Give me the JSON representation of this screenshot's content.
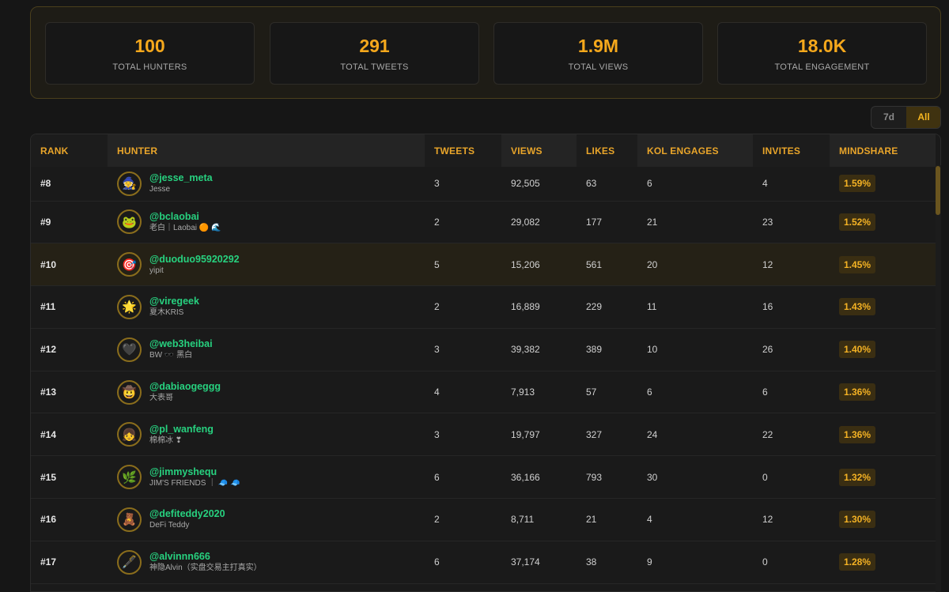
{
  "stats": [
    {
      "value": "100",
      "label": "TOTAL HUNTERS"
    },
    {
      "value": "291",
      "label": "TOTAL TWEETS"
    },
    {
      "value": "1.9M",
      "label": "TOTAL VIEWS"
    },
    {
      "value": "18.0K",
      "label": "TOTAL ENGAGEMENT"
    }
  ],
  "range": {
    "option_7d": "7d",
    "option_all": "All",
    "selected": "All"
  },
  "table": {
    "headers": {
      "rank": "RANK",
      "hunter": "HUNTER",
      "tweets": "TWEETS",
      "views": "VIEWS",
      "likes": "LIKES",
      "kol": "KOL ENGAGES",
      "invites": "INVITES",
      "mindshare": "MINDSHARE"
    },
    "rows": [
      {
        "rank": "#8",
        "handle": "@jesse_meta",
        "name": "Jesse",
        "avatar": "🧙",
        "tweets": "3",
        "views": "92,505",
        "likes": "63",
        "kol": "6",
        "invites": "4",
        "mindshare": "1.59%"
      },
      {
        "rank": "#9",
        "handle": "@bclaobai",
        "name": "老白｜Laobai 🟠 🌊",
        "avatar": "🐸",
        "tweets": "2",
        "views": "29,082",
        "likes": "177",
        "kol": "21",
        "invites": "23",
        "mindshare": "1.52%"
      },
      {
        "rank": "#10",
        "handle": "@duoduo95920292",
        "name": "yipit",
        "avatar": "🎯",
        "tweets": "5",
        "views": "15,206",
        "likes": "561",
        "kol": "20",
        "invites": "12",
        "mindshare": "1.45%"
      },
      {
        "rank": "#11",
        "handle": "@viregeek",
        "name": "夏木KRIS",
        "avatar": "🌟",
        "tweets": "2",
        "views": "16,889",
        "likes": "229",
        "kol": "11",
        "invites": "16",
        "mindshare": "1.43%"
      },
      {
        "rank": "#12",
        "handle": "@web3heibai",
        "name": "BW 🕶️ 黑白",
        "avatar": "🖤",
        "tweets": "3",
        "views": "39,382",
        "likes": "389",
        "kol": "10",
        "invites": "26",
        "mindshare": "1.40%"
      },
      {
        "rank": "#13",
        "handle": "@dabiaogeggg",
        "name": "大表哥",
        "avatar": "🤠",
        "tweets": "4",
        "views": "7,913",
        "likes": "57",
        "kol": "6",
        "invites": "6",
        "mindshare": "1.36%"
      },
      {
        "rank": "#14",
        "handle": "@pl_wanfeng",
        "name": "棉棉冰 ❣",
        "avatar": "👧",
        "tweets": "3",
        "views": "19,797",
        "likes": "327",
        "kol": "24",
        "invites": "22",
        "mindshare": "1.36%"
      },
      {
        "rank": "#15",
        "handle": "@jimmyshequ",
        "name": "JIM'S FRIENDS ｜ 🧢 🧢",
        "avatar": "🌿",
        "tweets": "6",
        "views": "36,166",
        "likes": "793",
        "kol": "30",
        "invites": "0",
        "mindshare": "1.32%"
      },
      {
        "rank": "#16",
        "handle": "@defiteddy2020",
        "name": "DeFi Teddy",
        "avatar": "🧸",
        "tweets": "2",
        "views": "8,711",
        "likes": "21",
        "kol": "4",
        "invites": "12",
        "mindshare": "1.30%"
      },
      {
        "rank": "#17",
        "handle": "@alvinnn666",
        "name": "神隐Alvin（实盘交易主打真实）",
        "avatar": "🖋️",
        "tweets": "6",
        "views": "37,174",
        "likes": "38",
        "kol": "9",
        "invites": "0",
        "mindshare": "1.28%"
      }
    ]
  }
}
